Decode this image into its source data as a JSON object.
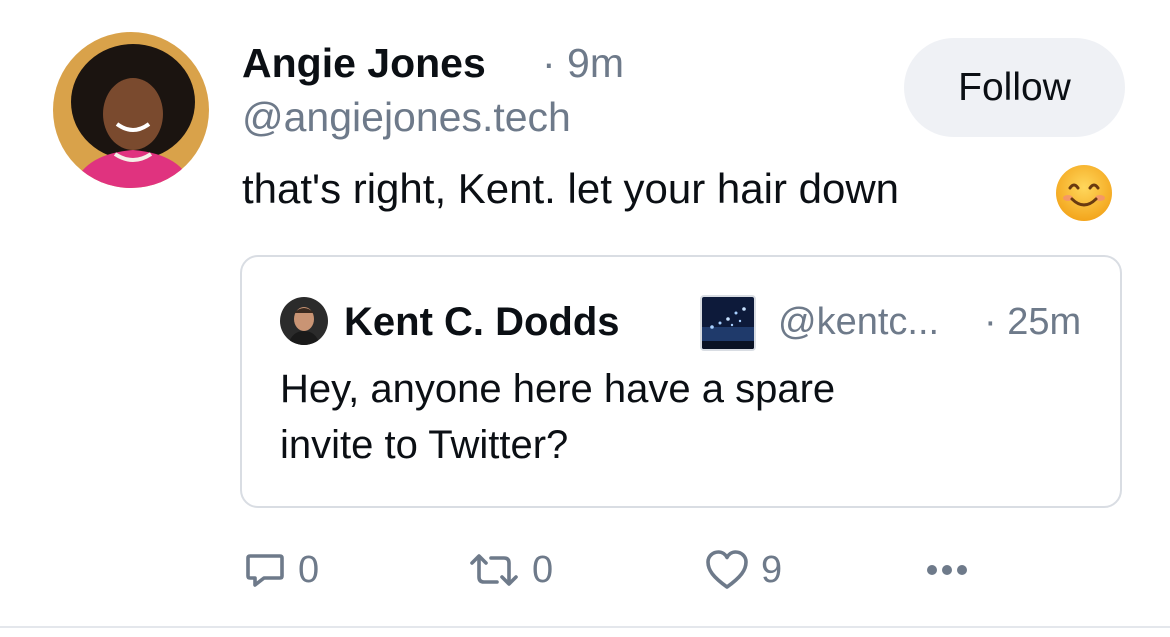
{
  "post": {
    "author_name": "Angie Jones",
    "separator_time": "· 9m",
    "handle": "@angiejones.tech",
    "follow_label": "Follow",
    "text": "that's right, Kent. let your hair down",
    "emoji": "smiling-face-emoji",
    "avatar_icon": "angie-avatar"
  },
  "quote": {
    "author_name": "Kent C. Dodds",
    "handle": "@kentc...",
    "separator_time": "· 25m",
    "text": "Hey, anyone here have a spare\ninvite to Twitter?",
    "avatar_icon": "kent-avatar",
    "badge_icon": "starry-sky-badge"
  },
  "actions": {
    "reply_count": "0",
    "repost_count": "0",
    "like_count": "9",
    "reply_icon": "reply-icon",
    "repost_icon": "repost-icon",
    "like_icon": "heart-icon",
    "more_icon": "more-icon"
  },
  "colors": {
    "muted_text": "#6e7a8a",
    "follow_bg": "#eff1f5",
    "border": "#d9dde3"
  }
}
